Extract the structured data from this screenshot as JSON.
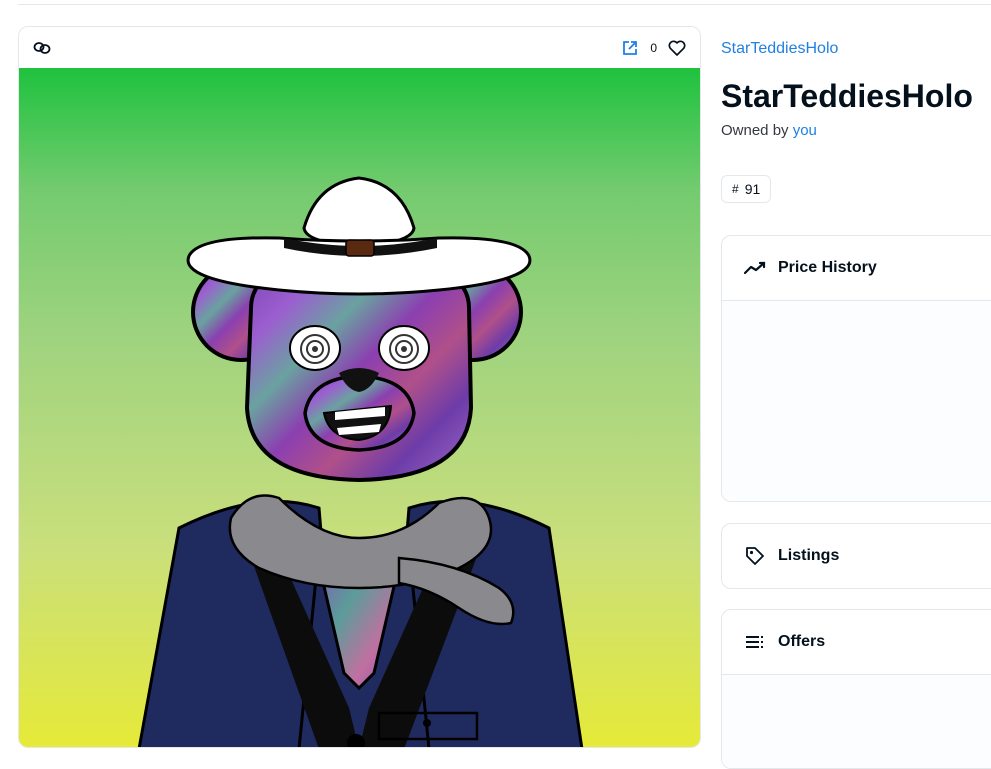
{
  "media": {
    "favorite_count": "0"
  },
  "item": {
    "collection_name": "StarTeddiesHolo",
    "title": "StarTeddiesHolo",
    "owned_by_prefix": "Owned by",
    "owner": "you",
    "token_hash": "#",
    "token_id": "91"
  },
  "panels": {
    "price_history": "Price History",
    "listings": "Listings",
    "offers": "Offers"
  },
  "colors": {
    "link": "#2081e2",
    "border": "#e5e8eb",
    "text": "#04111d"
  },
  "icons": [
    "chain-icon",
    "open-external-icon",
    "heart-icon",
    "trending-icon",
    "tag-icon",
    "list-icon"
  ]
}
